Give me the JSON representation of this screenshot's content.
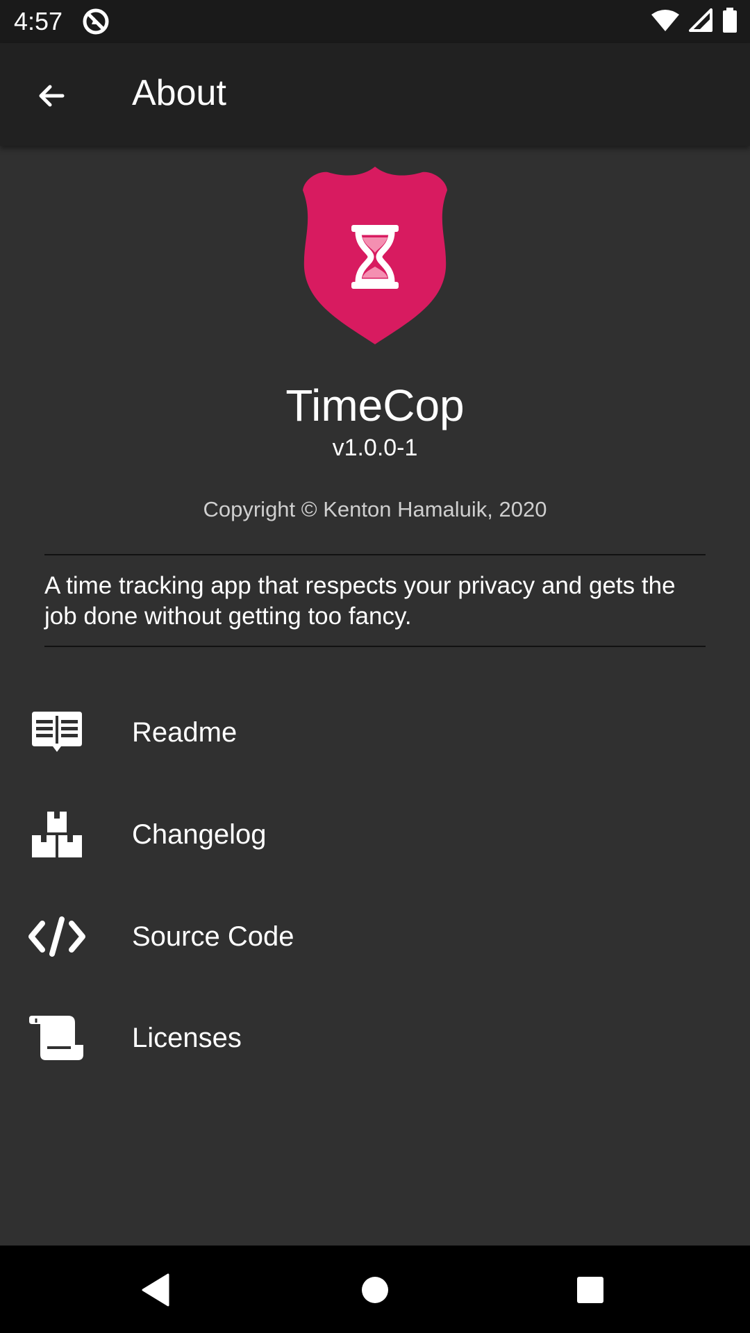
{
  "status_bar": {
    "time": "4:57"
  },
  "app_bar": {
    "title": "About"
  },
  "app": {
    "name": "TimeCop",
    "version": "v1.0.0-1",
    "copyright": "Copyright © Kenton Hamaluik, 2020",
    "description": "A time tracking app that respects your privacy and gets the job done without getting too fancy."
  },
  "menu": {
    "items": [
      {
        "label": "Readme",
        "icon": "book-open-icon"
      },
      {
        "label": "Changelog",
        "icon": "boxes-icon"
      },
      {
        "label": "Source Code",
        "icon": "code-icon"
      },
      {
        "label": "Licenses",
        "icon": "scroll-icon"
      }
    ]
  },
  "colors": {
    "accent": "#d81b60",
    "background": "#303030",
    "app_bar": "#212121"
  }
}
